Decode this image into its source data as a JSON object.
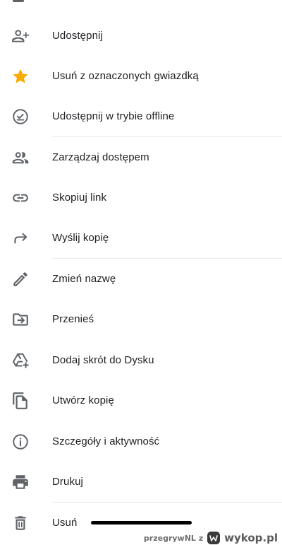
{
  "menu": {
    "items": [
      {
        "label": "Udostępnij",
        "icon": "person-add-icon"
      },
      {
        "label": "Usuń z oznaczonych gwiazdką",
        "icon": "star-icon"
      },
      {
        "label": "Udostępnij w trybie offline",
        "icon": "offline-check-icon"
      },
      {
        "label": "Zarządzaj dostępem",
        "icon": "people-icon"
      },
      {
        "label": "Skopiuj link",
        "icon": "link-icon"
      },
      {
        "label": "Wyślij kopię",
        "icon": "forward-arrow-icon"
      },
      {
        "label": "Zmień nazwę",
        "icon": "pencil-icon"
      },
      {
        "label": "Przenieś",
        "icon": "folder-move-icon"
      },
      {
        "label": "Dodaj skrót do Dysku",
        "icon": "drive-add-shortcut-icon"
      },
      {
        "label": "Utwórz kopię",
        "icon": "file-copy-icon"
      },
      {
        "label": "Szczegóły i aktywność",
        "icon": "info-icon"
      },
      {
        "label": "Drukuj",
        "icon": "printer-icon"
      },
      {
        "label": "Usuń",
        "icon": "trash-icon"
      }
    ]
  },
  "colors": {
    "icon": "#5f6368",
    "star": "#f9ab00",
    "text": "#202124",
    "divider": "#e8eaed"
  },
  "watermark": {
    "user": "przegrywNL",
    "connector": "z",
    "site": "wykop.pl"
  }
}
